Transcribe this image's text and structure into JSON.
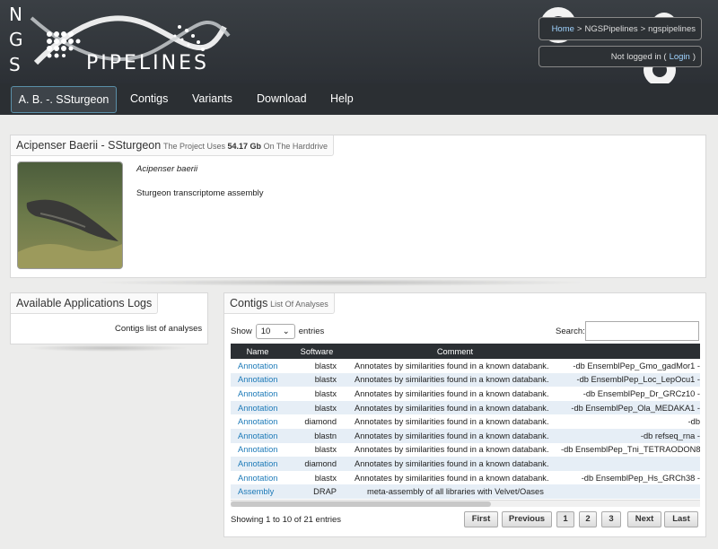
{
  "header": {
    "logo_letters": [
      "N",
      "G",
      "S"
    ],
    "logo_word": "PIPELINES",
    "breadcrumb": {
      "home": "Home",
      "sep": ">",
      "item1": "NGSPipelines",
      "item2": "ngspipelines"
    },
    "login": {
      "prefix": "Not logged in (",
      "link": "Login",
      "suffix": ")"
    }
  },
  "nav": {
    "active": "A. B. -. SSturgeon",
    "items": [
      "Contigs",
      "Variants",
      "Download",
      "Help"
    ]
  },
  "project": {
    "title": "Acipenser Baerii - SSturgeon",
    "usage_prefix": "The Project Uses",
    "usage_value": "54.17 Gb",
    "usage_suffix": "On The Harddrive",
    "species": "Acipenser baerii",
    "description": "Sturgeon transcriptome assembly"
  },
  "applog": {
    "title": "Available Applications Logs",
    "item": "Contigs list of analyses"
  },
  "contigs": {
    "title": "Contigs",
    "subtitle": "List Of Analyses",
    "show_label": "Show",
    "show_value": "10",
    "entries_label": "entries",
    "search_label": "Search:",
    "columns": [
      "Name",
      "Software",
      "Comment",
      ""
    ],
    "rows": [
      [
        "Annotation",
        "blastx",
        "Annotates by similarities found in a known databank.",
        "-db EnsemblPep_Gmo_gadMor1 -"
      ],
      [
        "Annotation",
        "blastx",
        "Annotates by similarities found in a known databank.",
        "-db EnsemblPep_Loc_LepOcu1 -"
      ],
      [
        "Annotation",
        "blastx",
        "Annotates by similarities found in a known databank.",
        "-db EnsemblPep_Dr_GRCz10 -"
      ],
      [
        "Annotation",
        "blastx",
        "Annotates by similarities found in a known databank.",
        "-db EnsemblPep_Ola_MEDAKA1 -"
      ],
      [
        "Annotation",
        "diamond",
        "Annotates by similarities found in a known databank.",
        "-db"
      ],
      [
        "Annotation",
        "blastn",
        "Annotates by similarities found in a known databank.",
        "-db refseq_rna -"
      ],
      [
        "Annotation",
        "blastx",
        "Annotates by similarities found in a known databank.",
        "-db EnsemblPep_Tni_TETRAODON8 -"
      ],
      [
        "Annotation",
        "diamond",
        "Annotates by similarities found in a known databank.",
        ""
      ],
      [
        "Annotation",
        "blastx",
        "Annotates by similarities found in a known databank.",
        "-db EnsemblPep_Hs_GRCh38 -"
      ],
      [
        "Assembly",
        "DRAP",
        "meta-assembly of all libraries with Velvet/Oases",
        ""
      ]
    ],
    "info": "Showing 1 to 10 of 21 entries",
    "pagination": {
      "first": "First",
      "previous": "Previous",
      "pages": [
        "1",
        "2",
        "3"
      ],
      "next": "Next",
      "last": "Last"
    }
  }
}
